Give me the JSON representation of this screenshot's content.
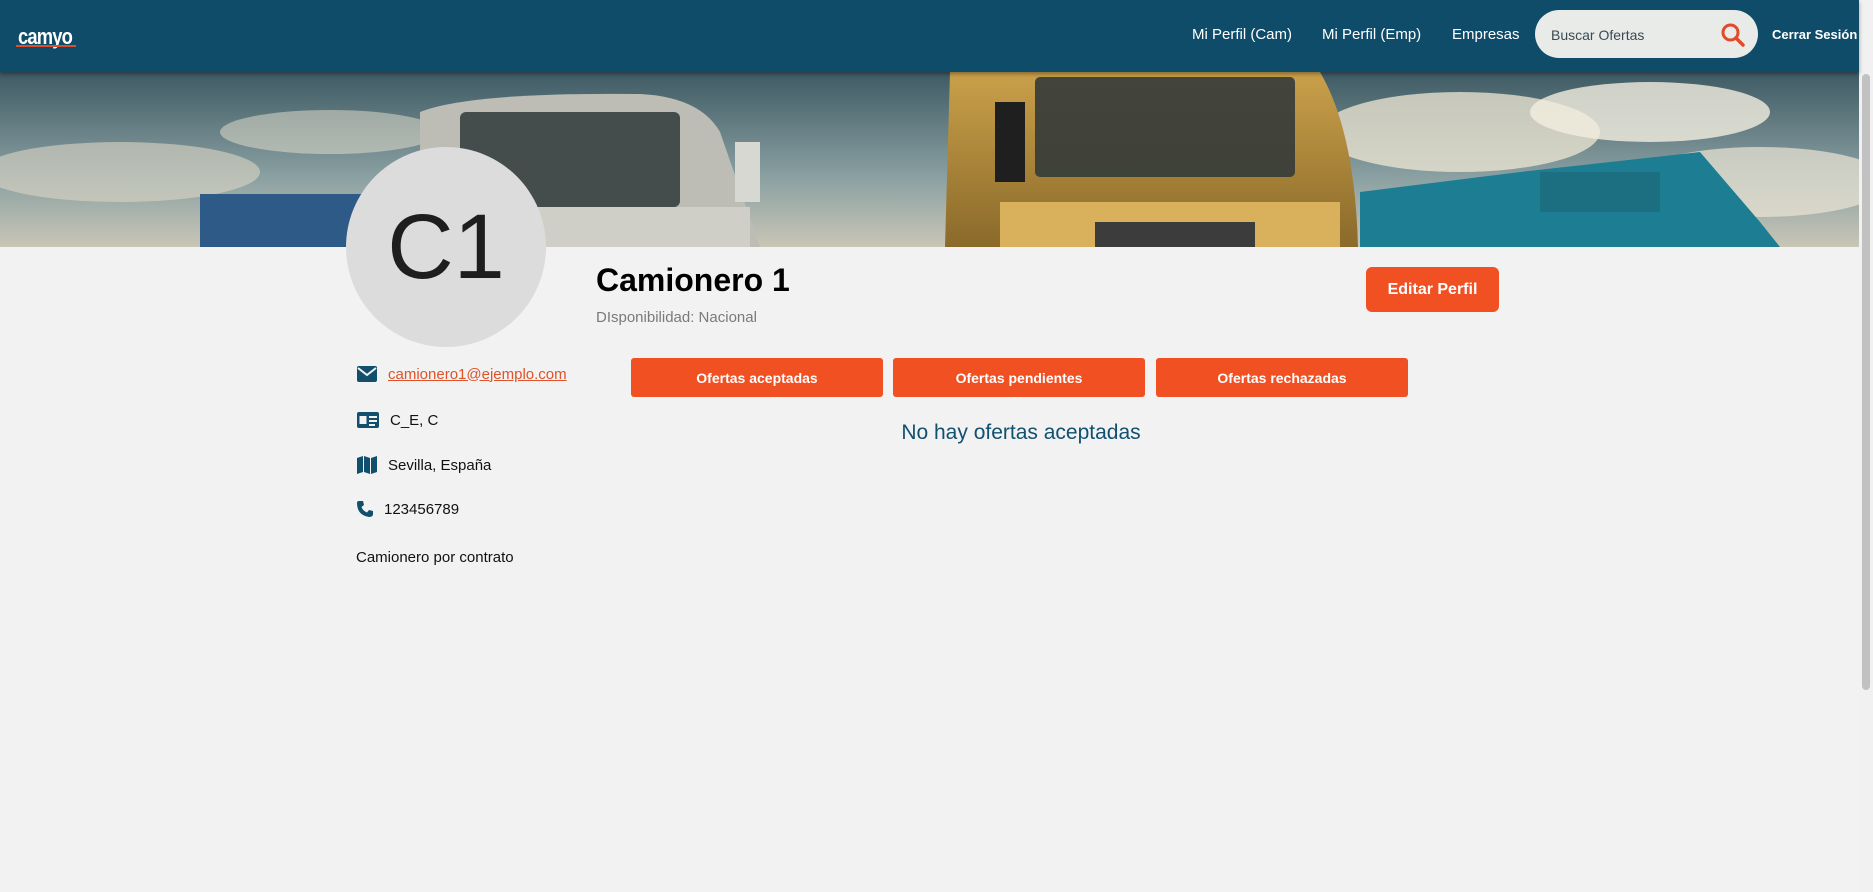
{
  "navbar": {
    "logo_text": "camyo",
    "links": [
      "Mi Perfil (Cam)",
      "Mi Perfil (Emp)",
      "Empresas"
    ],
    "search_placeholder": "Buscar Ofertas",
    "search_icon": "search-icon",
    "logout_label": "Cerrar Sesión"
  },
  "profile": {
    "initials": "C1",
    "name": "Camionero 1",
    "availability": "DIsponibilidad: Nacional",
    "edit_label": "Editar Perfil",
    "email": "camionero1@ejemplo.com",
    "license": "C_E, C",
    "location": "Sevilla, España",
    "phone": "123456789",
    "role": "Camionero por contrato"
  },
  "tabs": [
    "Ofertas aceptadas",
    "Ofertas pendientes",
    "Ofertas rechazadas"
  ],
  "empty_message": "No hay ofertas aceptadas",
  "colors": {
    "navbar": "#0f4c6a",
    "accent": "#f15023",
    "background": "#f2f2f2",
    "empty_text": "#11506f"
  }
}
